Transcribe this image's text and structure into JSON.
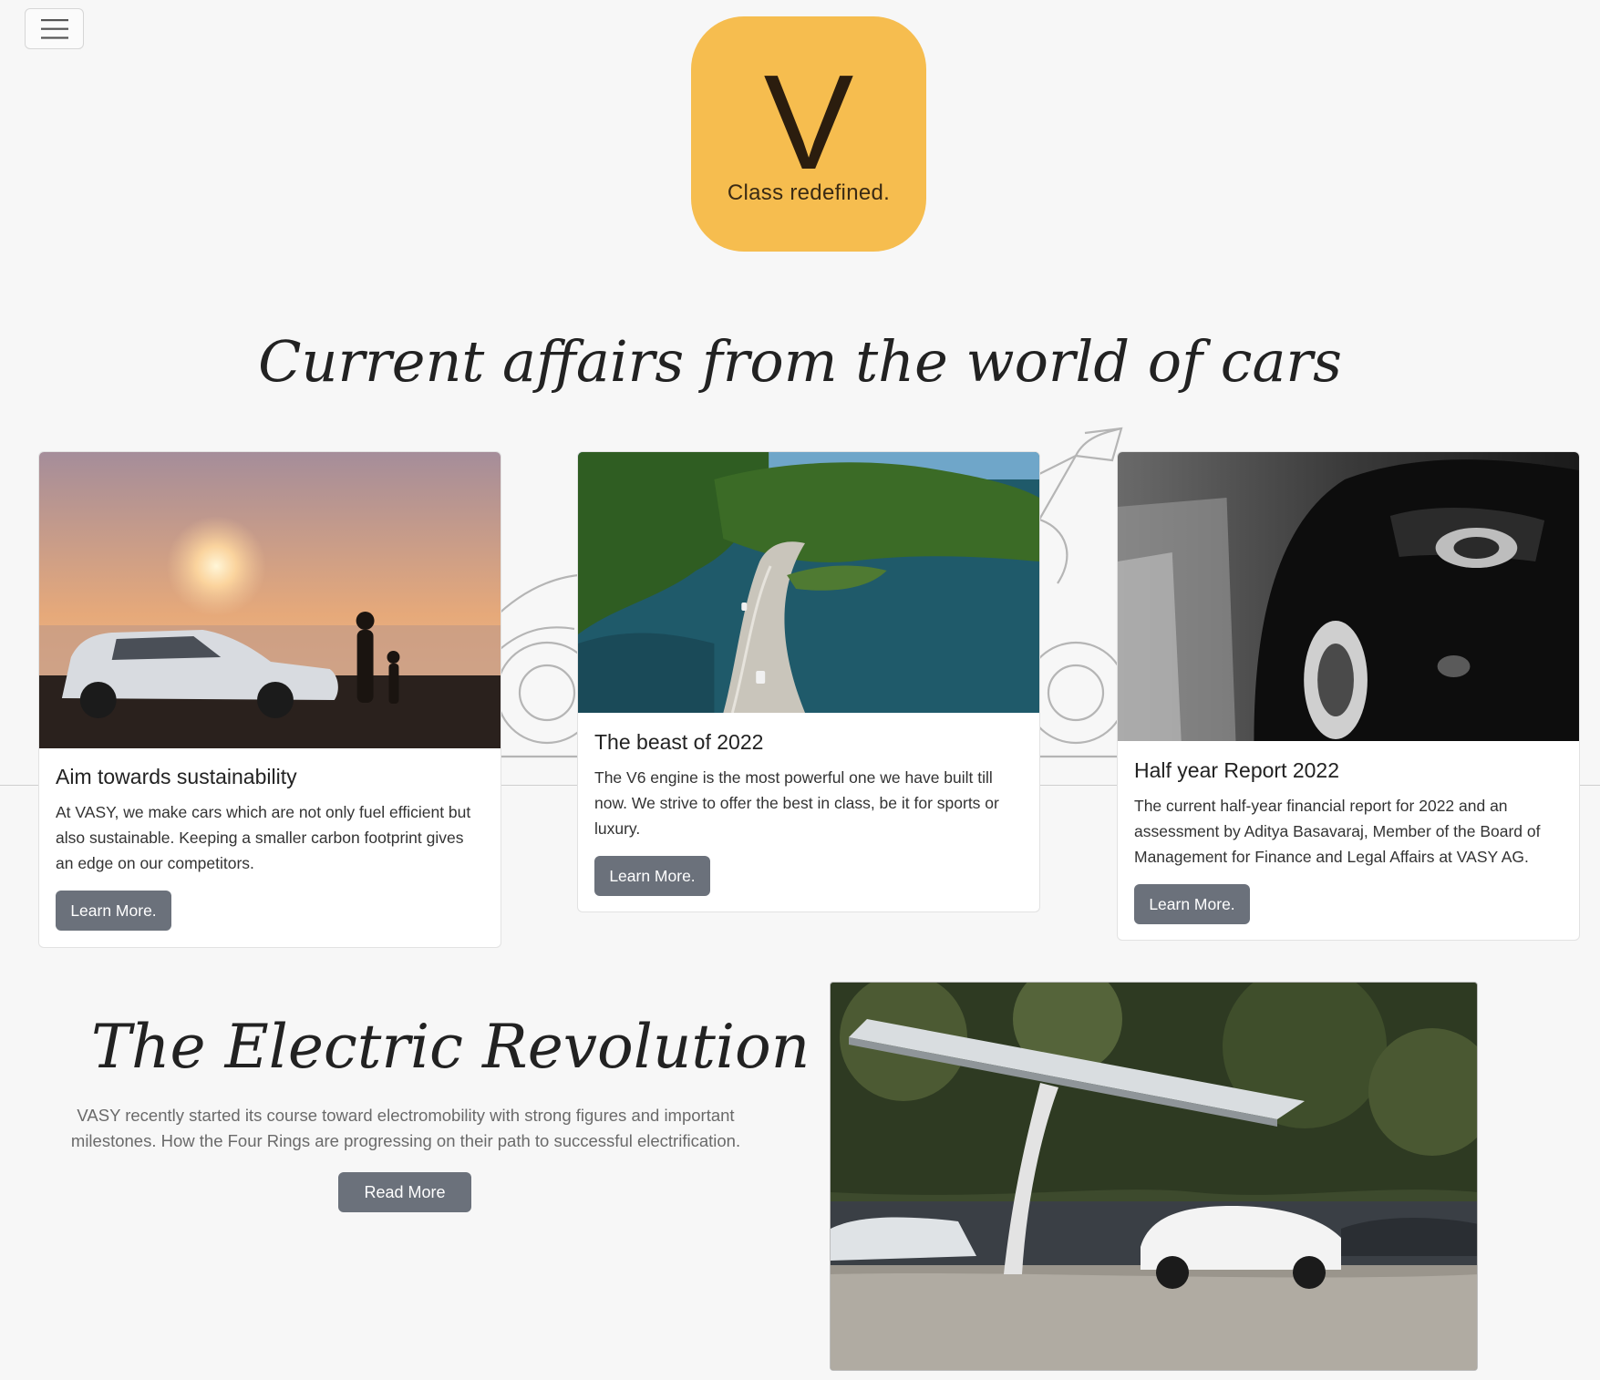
{
  "logo": {
    "letter": "V",
    "tagline": "Class redefined."
  },
  "section_heading": "Current affairs from the world of cars",
  "cards": [
    {
      "title": "Aim towards sustainability",
      "text": "At VASY, we make cars which are not only fuel efficient but also sustainable. Keeping a smaller carbon footprint gives an edge on our competitors.",
      "button": "Learn More."
    },
    {
      "title": "The beast of 2022",
      "text": "The V6 engine is the most powerful one we have built till now. We strive to offer the best in class, be it for sports or luxury.",
      "button": "Learn More."
    },
    {
      "title": "Half year Report 2022",
      "text": "The current half-year financial report for 2022 and an assessment by Aditya Basavaraj, Member of the Board of Management for Finance and Legal Affairs at VASY AG.",
      "button": "Learn More."
    }
  ],
  "electric": {
    "heading": "The Electric Revolution",
    "text": "VASY recently started its course toward electromobility with strong figures and important milestones. How the Four Rings are progressing on their path to successful electrification.",
    "button": "Read More"
  },
  "colors": {
    "logo_bg": "#f6bd4f",
    "button_bg": "#6b717b",
    "page_bg": "#f7f7f7"
  },
  "icons": {
    "nav": "hamburger-menu-icon"
  }
}
